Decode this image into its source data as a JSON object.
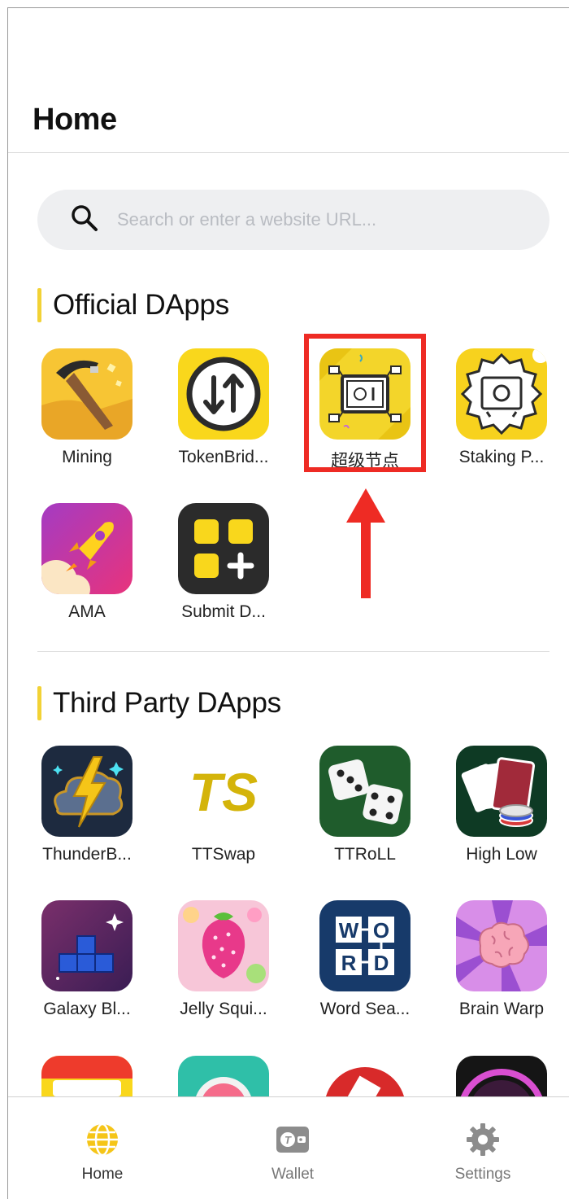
{
  "header": {
    "title": "Home"
  },
  "search": {
    "placeholder": "Search or enter a website URL..."
  },
  "official": {
    "title": "Official DApps",
    "apps": [
      {
        "label": "Mining",
        "icon": "pickaxe-icon"
      },
      {
        "label": "TokenBrid...",
        "icon": "token-bridge-icon"
      },
      {
        "label": "超级节点",
        "icon": "super-node-icon"
      },
      {
        "label": "Staking P...",
        "icon": "staking-safe-icon"
      },
      {
        "label": "AMA",
        "icon": "rocket-icon"
      },
      {
        "label": "Submit D...",
        "icon": "submit-dapp-icon"
      }
    ]
  },
  "third_party": {
    "title": "Third Party DApps",
    "apps": [
      {
        "label": "ThunderB...",
        "icon": "thunder-cloud-icon"
      },
      {
        "label": "TTSwap",
        "icon": "ttswap-logo",
        "logo_text": "TS"
      },
      {
        "label": "TTRoLL",
        "icon": "dice-icon"
      },
      {
        "label": "High Low",
        "icon": "cards-chips-icon"
      },
      {
        "label": "Galaxy Bl...",
        "icon": "galaxy-blocks-icon"
      },
      {
        "label": "Jelly Squi...",
        "icon": "jelly-strawberry-icon"
      },
      {
        "label": "Word Sea...",
        "icon": "word-search-icon",
        "logo_letters": [
          "W",
          "O",
          "R",
          "D"
        ]
      },
      {
        "label": "Brain Warp",
        "icon": "brain-icon"
      }
    ]
  },
  "tabbar": {
    "items": [
      {
        "label": "Home",
        "icon": "globe-icon",
        "active": true
      },
      {
        "label": "Wallet",
        "icon": "wallet-icon",
        "active": false
      },
      {
        "label": "Settings",
        "icon": "gear-icon",
        "active": false
      }
    ]
  },
  "colors": {
    "accent": "#f2d235",
    "highlight": "#ee2b24",
    "search_bg": "#eeeff1",
    "active_tab": "#f5c518"
  }
}
